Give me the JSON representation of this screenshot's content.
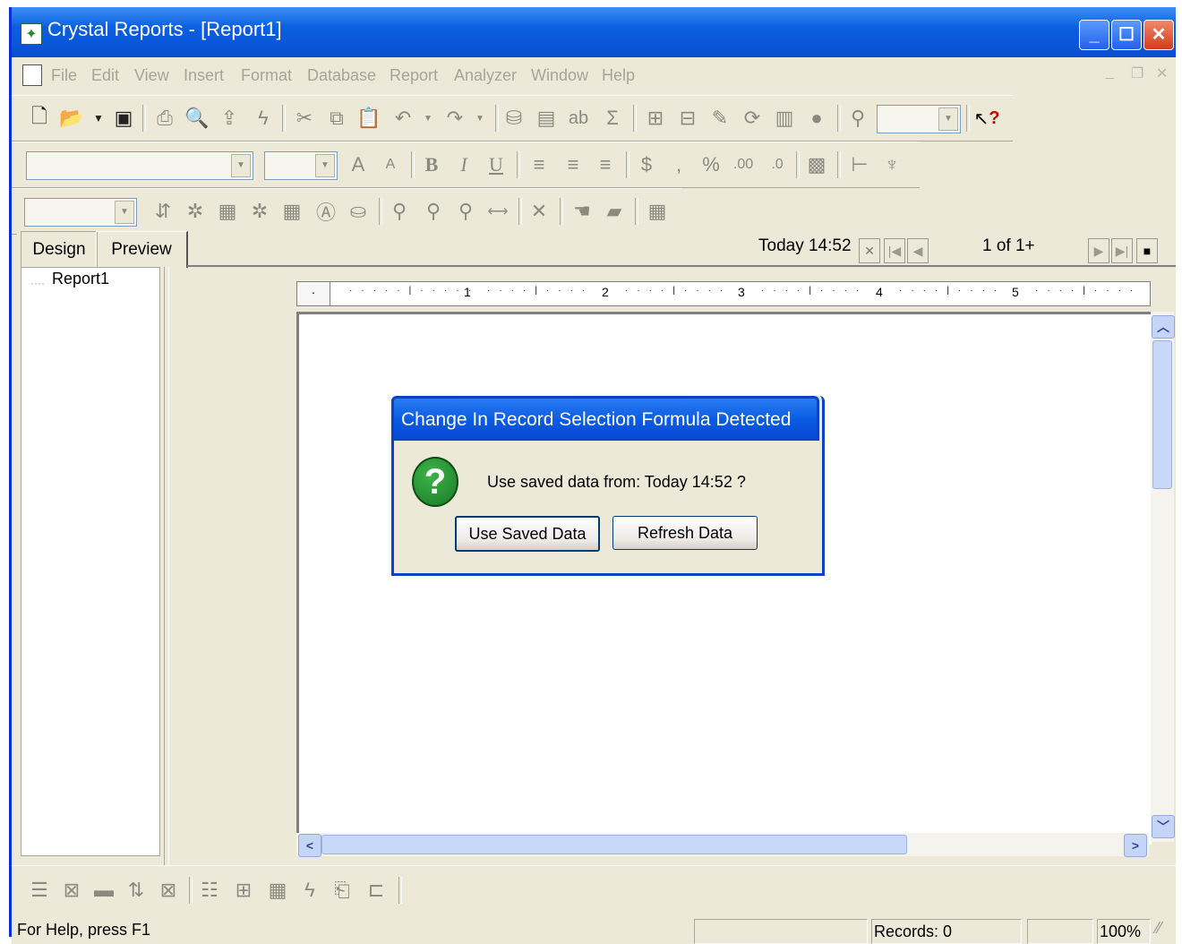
{
  "window": {
    "title": "Crystal Reports - [Report1]"
  },
  "menu": [
    "File",
    "Edit",
    "View",
    "Insert",
    "Format",
    "Database",
    "Report",
    "Analyzer",
    "Window",
    "Help"
  ],
  "tabs": {
    "design": "Design",
    "preview": "Preview"
  },
  "preview_nav": {
    "data_date": "Today  14:52",
    "page_indicator": "1 of 1+"
  },
  "tree": {
    "root": "Report1"
  },
  "ruler": {
    "marks": [
      "1",
      "2",
      "3",
      "4",
      "5"
    ]
  },
  "dialog": {
    "title": "Change In Record Selection Formula Detected",
    "message": "Use saved data from: Today  14:52 ?",
    "use_saved_label": "Use Saved Data",
    "refresh_label": "Refresh Data"
  },
  "statusbar": {
    "help": "For Help, press F1",
    "records": "Records:  0",
    "zoom": "100%"
  },
  "colors": {
    "titlebar": "#0a5fe0",
    "chrome": "#ece9d8",
    "dialog_border": "#0843c8"
  }
}
